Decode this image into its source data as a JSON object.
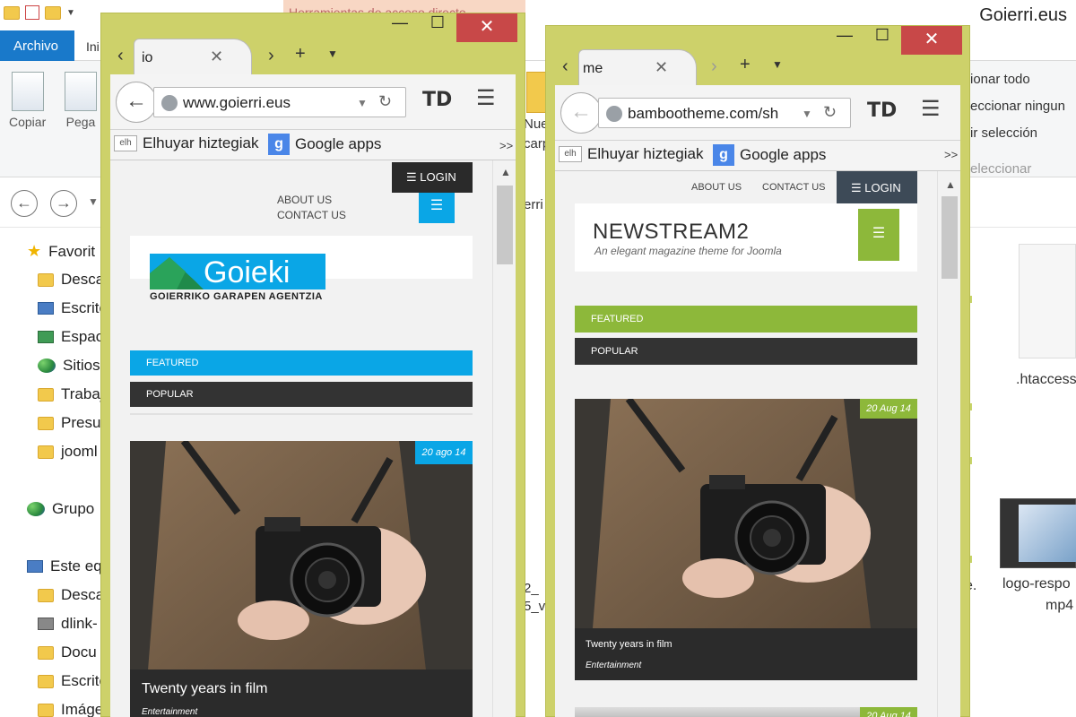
{
  "explorer": {
    "title": "Goierri.eus",
    "tools_tab": "Herramientas de acceso directo",
    "tabs": {
      "archivo": "Archivo",
      "inicio": "Ini"
    },
    "ribbon": {
      "copiar": "Copiar",
      "pegar": "Pega",
      "nueva_1": "Nue",
      "nueva_2": "carp"
    },
    "right_ribbon": [
      "ionar todo",
      "eccionar ningun",
      "ir selección",
      "eleccionar"
    ],
    "tree": [
      "Favorit",
      "Desca",
      "Escrito",
      "Espac",
      "Sitios",
      "Trabaj",
      "Presu",
      "jooml",
      "Grupo",
      "Este eq",
      "Desca",
      "dlink-",
      "Docu",
      "Escrito",
      "Imáge"
    ],
    "mid_text": [
      "erri",
      "2_",
      "5_v"
    ],
    "files": [
      ".htaccess",
      "e.",
      "logo-respo",
      "mp4"
    ]
  },
  "colors": {
    "window_frame": "#cdd16a",
    "close_red": "#c84848",
    "goierri_accent": "#0aa6e6",
    "newstream_accent": "#8db83a",
    "dark_bar": "#2b2b2b"
  },
  "browser1": {
    "tab_label": "io",
    "url": "www.goierri.eus",
    "bookmarks": {
      "elh_icon": "elh",
      "b1": "Elhuyar hiztegiak",
      "g_icon": "g",
      "b2": "Google apps",
      "more": ">>"
    },
    "td_label": "TD",
    "site": {
      "login": "LOGIN",
      "about": "ABOUT US",
      "contact": "CONTACT US",
      "logo_text": "Goieki",
      "logo_sub": "GOIERRIKO GARAPEN AGENTZIA",
      "featured": "FEATURED",
      "popular": "POPULAR",
      "date": "20 ago 14",
      "post_title": "Twenty years in film",
      "post_category": "Entertainment"
    }
  },
  "browser2": {
    "tab_label": "me",
    "url": "bambootheme.com/sh",
    "bookmarks": {
      "elh_icon": "elh",
      "b1": "Elhuyar hiztegiak",
      "g_icon": "g",
      "b2": "Google apps",
      "more": ">>"
    },
    "td_label": "TD",
    "site": {
      "about": "ABOUT US",
      "contact": "CONTACT US",
      "login": "LOGIN",
      "site_title": "NEWSTREAM2",
      "tagline": "An elegant magazine theme for Joomla",
      "featured": "FEATURED",
      "popular": "POPULAR",
      "date": "20 Aug 14",
      "post_title": "Twenty years in film",
      "post_category": "Entertainment",
      "date2": "20 Aug 14"
    }
  }
}
